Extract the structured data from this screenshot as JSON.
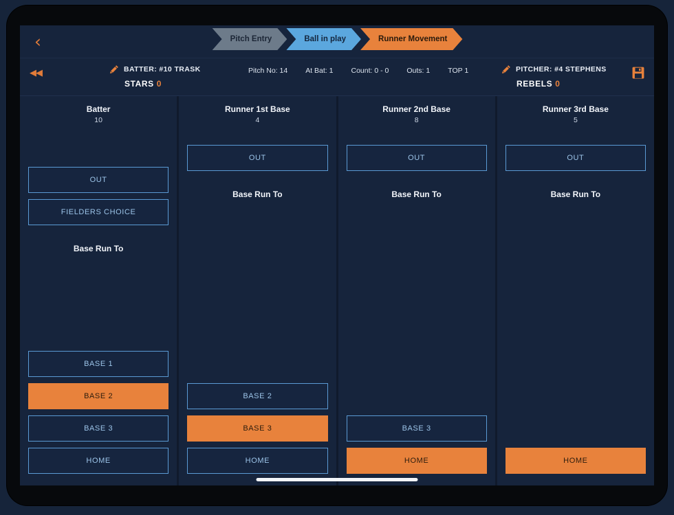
{
  "nav": {
    "back_icon": "chevron-left-icon",
    "steps": [
      {
        "label": "Pitch Entry",
        "state": "done"
      },
      {
        "label": "Ball in play",
        "state": "done"
      },
      {
        "label": "Runner Movement",
        "state": "active"
      }
    ]
  },
  "infobar": {
    "rewind_icon": "rewind-icon",
    "save_icon": "save-icon",
    "batter": {
      "edit_icon": "pencil-icon",
      "label": "BATTER: #10 TRASK",
      "team": "STARS",
      "score": "0"
    },
    "pitcher": {
      "edit_icon": "pencil-icon",
      "label": "PITCHER: #4 STEPHENS",
      "team": "REBELS",
      "score": "0"
    },
    "stats": [
      "Pitch No: 14",
      "At Bat: 1",
      "Count: 0 - 0",
      "Outs: 1",
      "TOP  1"
    ]
  },
  "columns": [
    {
      "title": "Batter",
      "number": "10",
      "actions": [
        {
          "label": "OUT",
          "selected": false
        },
        {
          "label": "FIELDERS CHOICE",
          "selected": false
        }
      ],
      "base_run_label": "Base Run To",
      "bases": [
        {
          "label": "BASE 1",
          "selected": false
        },
        {
          "label": "BASE 2",
          "selected": true
        },
        {
          "label": "BASE 3",
          "selected": false
        },
        {
          "label": "HOME",
          "selected": false
        }
      ]
    },
    {
      "title": "Runner 1st Base",
      "number": "4",
      "actions": [
        {
          "label": "OUT",
          "selected": false
        }
      ],
      "base_run_label": "Base Run To",
      "bases": [
        {
          "label": "BASE 2",
          "selected": false
        },
        {
          "label": "BASE 3",
          "selected": true
        },
        {
          "label": "HOME",
          "selected": false
        }
      ]
    },
    {
      "title": "Runner 2nd Base",
      "number": "8",
      "actions": [
        {
          "label": "OUT",
          "selected": false
        }
      ],
      "base_run_label": "Base Run To",
      "bases": [
        {
          "label": "BASE 3",
          "selected": false
        },
        {
          "label": "HOME",
          "selected": true
        }
      ]
    },
    {
      "title": "Runner 3rd Base",
      "number": "5",
      "actions": [
        {
          "label": "OUT",
          "selected": false
        }
      ],
      "base_run_label": "Base Run To",
      "bases": [
        {
          "label": "HOME",
          "selected": true
        }
      ]
    }
  ],
  "colors": {
    "accent": "#e8823c",
    "outline": "#5b9bd5",
    "panel": "#16243c",
    "step_done": "#6d7b8a",
    "step_current": "#5ba7de"
  }
}
